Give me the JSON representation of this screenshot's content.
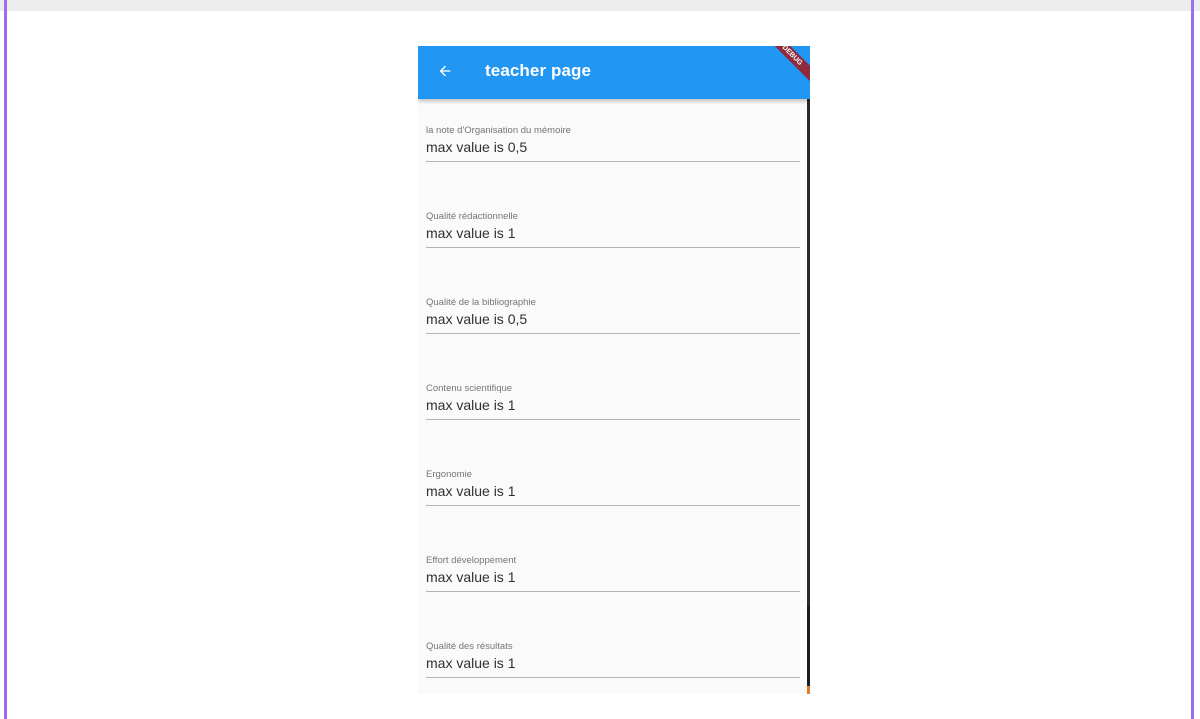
{
  "app_bar": {
    "title": "teacher page",
    "back_icon": "arrow-back-icon",
    "color": "#2196f3",
    "debug_banner": "DEBUG"
  },
  "fields": [
    {
      "label": "la note d'Organisation du mémoire",
      "placeholder": "max value is 0,5"
    },
    {
      "label": "Qualité rédactionnelle",
      "placeholder": "max value is 1"
    },
    {
      "label": "Qualité de la bibliographie",
      "placeholder": "max value is 0,5"
    },
    {
      "label": "Contenu scientifique",
      "placeholder": "max value is 1"
    },
    {
      "label": "Ergonomie",
      "placeholder": "max value is 1"
    },
    {
      "label": "Effort développement",
      "placeholder": "max value is 1"
    },
    {
      "label": "Qualité  des résultats",
      "placeholder": "max value is 1"
    }
  ]
}
